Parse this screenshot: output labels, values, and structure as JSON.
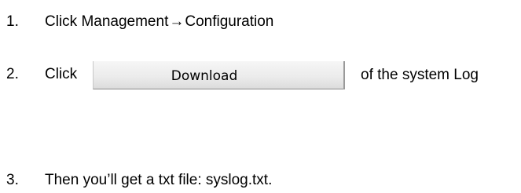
{
  "steps": [
    {
      "number": "1.",
      "text_before_arrow": "Click Management",
      "arrow": "→",
      "text_after_arrow": "Configuration"
    },
    {
      "number": "2.",
      "text_before_button": "Click",
      "button_label": "Download",
      "text_after_button": "of the system Log"
    },
    {
      "number": "3.",
      "text": "Then you’ll get a txt file: syslog.txt."
    }
  ]
}
